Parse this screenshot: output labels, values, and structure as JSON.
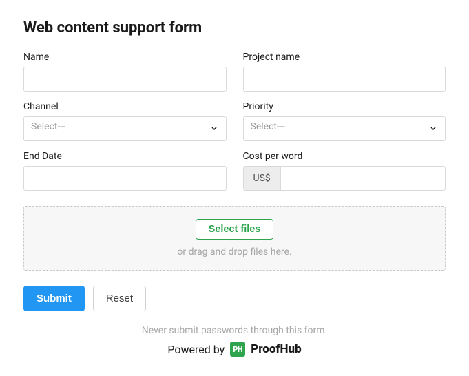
{
  "title": "Web content support form",
  "fields": {
    "name": {
      "label": "Name",
      "value": ""
    },
    "project": {
      "label": "Project name",
      "value": ""
    },
    "channel": {
      "label": "Channel",
      "placeholder": "Select---"
    },
    "priority": {
      "label": "Priority",
      "placeholder": "Select---"
    },
    "end_date": {
      "label": "End Date",
      "value": ""
    },
    "cost": {
      "label": "Cost per word",
      "currency": "US$",
      "value": ""
    }
  },
  "dropzone": {
    "button": "Select files",
    "hint": "or drag and drop files here."
  },
  "actions": {
    "submit": "Submit",
    "reset": "Reset"
  },
  "footer": {
    "note": "Never submit passwords through this form.",
    "powered_label": "Powered by",
    "brand_abbrev": "PH",
    "brand_name": "ProofHub"
  }
}
